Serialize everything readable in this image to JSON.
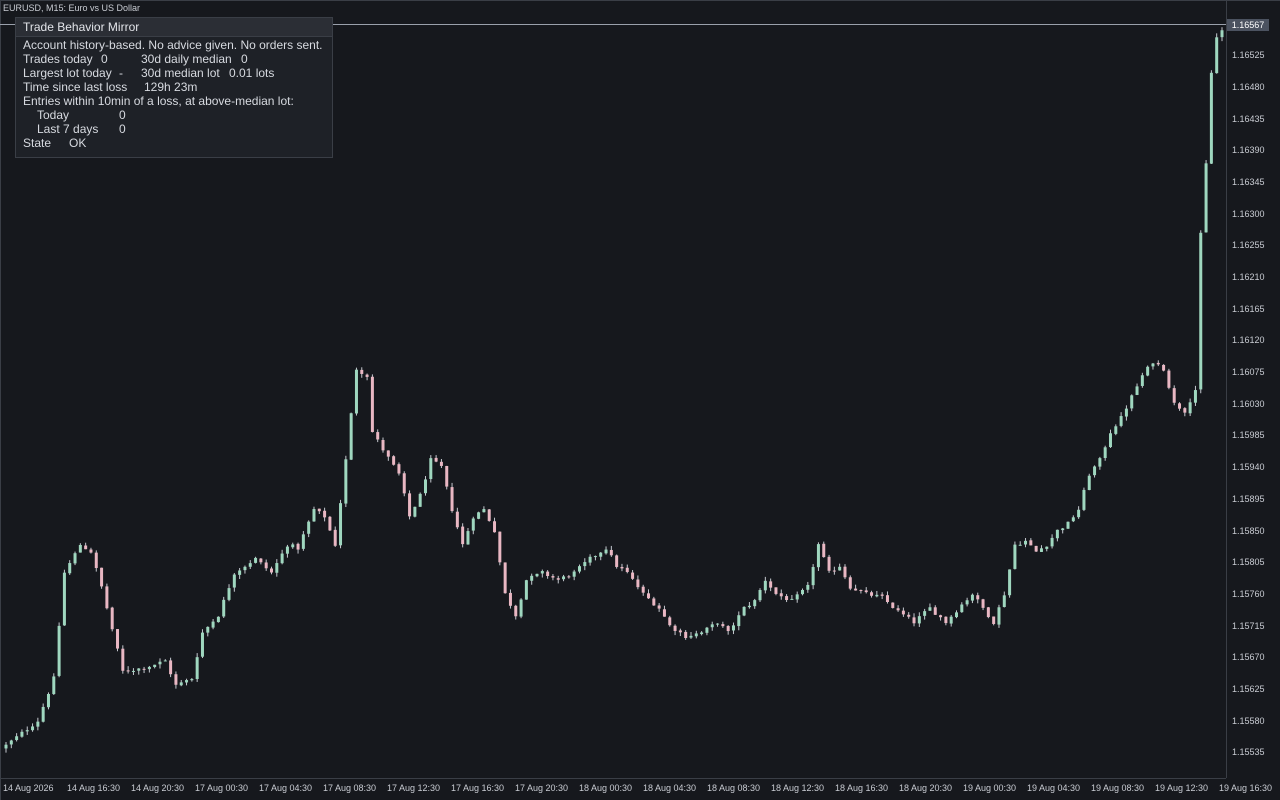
{
  "window": {
    "title": "EURUSD, M15:  Euro vs US Dollar"
  },
  "panel": {
    "title": "Trade Behavior Mirror",
    "disclaimer": "Account history-based. No advice given. No orders sent.",
    "trades_today_label": "Trades today",
    "trades_today_value": "0",
    "daily_median_label": "30d daily median",
    "daily_median_value": "0",
    "largest_lot_label": "Largest lot today",
    "largest_lot_value": "-",
    "median_lot_label": "30d median lot",
    "median_lot_value": "0.01 lots",
    "time_since_loss_label": "Time since last loss",
    "time_since_loss_value": "129h 23m",
    "entries_heading": "Entries within 10min of a loss, at above-median lot:",
    "today_label": "Today",
    "today_value": "0",
    "last7_label": "Last 7 days",
    "last7_value": "0",
    "state_label": "State",
    "state_value": "OK"
  },
  "price_axis": {
    "current_price": "1.16567",
    "labels": [
      "1.16525",
      "1.16480",
      "1.16435",
      "1.16390",
      "1.16345",
      "1.16300",
      "1.16255",
      "1.16210",
      "1.16165",
      "1.16120",
      "1.16075",
      "1.16030",
      "1.15985",
      "1.15940",
      "1.15895",
      "1.15850",
      "1.15805",
      "1.15760",
      "1.15715",
      "1.15670",
      "1.15625",
      "1.15580",
      "1.15535"
    ]
  },
  "time_axis": {
    "labels": [
      "14 Aug 2026",
      "14 Aug 16:30",
      "14 Aug 20:30",
      "17 Aug 00:30",
      "17 Aug 04:30",
      "17 Aug 08:30",
      "17 Aug 12:30",
      "17 Aug 16:30",
      "17 Aug 20:30",
      "18 Aug 00:30",
      "18 Aug 04:30",
      "18 Aug 08:30",
      "18 Aug 12:30",
      "18 Aug 16:30",
      "18 Aug 20:30",
      "19 Aug 00:30",
      "19 Aug 04:30",
      "19 Aug 08:30",
      "19 Aug 12:30",
      "19 Aug 16:30"
    ]
  },
  "colors": {
    "background": "#16181d",
    "bull_candle": "#9fd7bf",
    "bear_candle": "#e9b7c3",
    "wick": "#c5c9d0",
    "price_line": "#9aa0ab"
  },
  "chart_data": {
    "type": "candlestick",
    "symbol": "EURUSD",
    "timeframe": "M15",
    "ylim": [
      1.1551,
      1.16575
    ],
    "close_path": [
      [
        0,
        1.15545
      ],
      [
        6,
        1.1558
      ],
      [
        9,
        1.1564
      ],
      [
        11,
        1.1579
      ],
      [
        14,
        1.1583
      ],
      [
        16,
        1.1582
      ],
      [
        18,
        1.1577
      ],
      [
        20,
        1.1571
      ],
      [
        22,
        1.1565
      ],
      [
        26,
        1.15655
      ],
      [
        30,
        1.15665
      ],
      [
        32,
        1.1563
      ],
      [
        35,
        1.1564
      ],
      [
        37,
        1.15705
      ],
      [
        40,
        1.1573
      ],
      [
        43,
        1.1579
      ],
      [
        47,
        1.1581
      ],
      [
        50,
        1.1579
      ],
      [
        53,
        1.1583
      ],
      [
        55,
        1.15825
      ],
      [
        58,
        1.1588
      ],
      [
        60,
        1.1587
      ],
      [
        62,
        1.1583
      ],
      [
        64,
        1.1595
      ],
      [
        66,
        1.1608
      ],
      [
        68,
        1.1607
      ],
      [
        69,
        1.1599
      ],
      [
        71,
        1.15965
      ],
      [
        74,
        1.1593
      ],
      [
        76,
        1.1587
      ],
      [
        78,
        1.159
      ],
      [
        80,
        1.1595
      ],
      [
        82,
        1.1594
      ],
      [
        84,
        1.1588
      ],
      [
        86,
        1.1583
      ],
      [
        88,
        1.1587
      ],
      [
        90,
        1.1588
      ],
      [
        92,
        1.1585
      ],
      [
        94,
        1.1576
      ],
      [
        96,
        1.1573
      ],
      [
        98,
        1.1578
      ],
      [
        101,
        1.1579
      ],
      [
        104,
        1.1578
      ],
      [
        107,
        1.1579
      ],
      [
        110,
        1.1581
      ],
      [
        113,
        1.15825
      ],
      [
        115,
        1.158
      ],
      [
        117,
        1.1579
      ],
      [
        120,
        1.1576
      ],
      [
        123,
        1.1574
      ],
      [
        125,
        1.15715
      ],
      [
        128,
        1.157
      ],
      [
        131,
        1.15705
      ],
      [
        134,
        1.1572
      ],
      [
        136,
        1.15705
      ],
      [
        139,
        1.1574
      ],
      [
        141,
        1.1575
      ],
      [
        143,
        1.1578
      ],
      [
        145,
        1.1576
      ],
      [
        148,
        1.1575
      ],
      [
        151,
        1.1577
      ],
      [
        153,
        1.1583
      ],
      [
        155,
        1.1579
      ],
      [
        157,
        1.158
      ],
      [
        159,
        1.1577
      ],
      [
        162,
        1.1576
      ],
      [
        165,
        1.15755
      ],
      [
        168,
        1.15735
      ],
      [
        171,
        1.1572
      ],
      [
        174,
        1.1574
      ],
      [
        177,
        1.1572
      ],
      [
        180,
        1.15745
      ],
      [
        182,
        1.1576
      ],
      [
        184,
        1.1574
      ],
      [
        186,
        1.1572
      ],
      [
        188,
        1.1576
      ],
      [
        190,
        1.1583
      ],
      [
        192,
        1.15835
      ],
      [
        194,
        1.1582
      ],
      [
        196,
        1.1583
      ],
      [
        198,
        1.1585
      ],
      [
        200,
        1.1586
      ],
      [
        202,
        1.1588
      ],
      [
        204,
        1.1593
      ],
      [
        206,
        1.1595
      ],
      [
        208,
        1.1599
      ],
      [
        210,
        1.1601
      ],
      [
        212,
        1.1604
      ],
      [
        214,
        1.1607
      ],
      [
        216,
        1.1609
      ],
      [
        218,
        1.1608
      ],
      [
        220,
        1.1603
      ],
      [
        222,
        1.1602
      ],
      [
        224,
        1.1605
      ],
      [
        225,
        1.1627
      ],
      [
        226,
        1.1637
      ],
      [
        227,
        1.165
      ],
      [
        228,
        1.1655
      ],
      [
        229,
        1.1656
      ]
    ]
  }
}
